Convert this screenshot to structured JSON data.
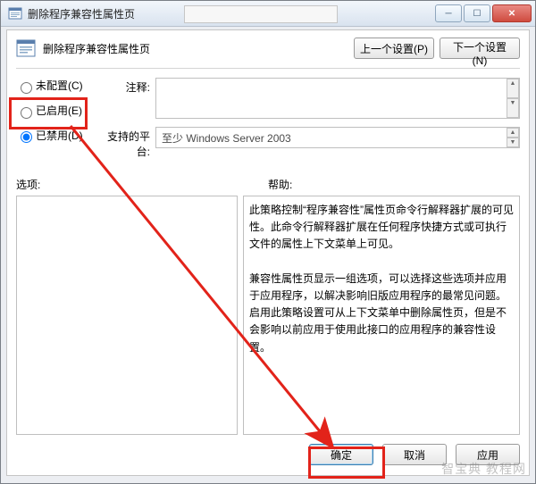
{
  "window": {
    "title": "删除程序兼容性属性页",
    "min_tip": "最小化",
    "max_tip": "最大化",
    "close_tip": "关闭"
  },
  "header": {
    "title": "删除程序兼容性属性页",
    "prev": "上一个设置(P)",
    "next": "下一个设置(N)"
  },
  "config": {
    "not_configured": "未配置(C)",
    "enabled": "已启用(E)",
    "disabled": "已禁用(D)",
    "selected": "disabled",
    "note_label": "注释:",
    "note_value": "",
    "platform_label": "支持的平台:",
    "platform_value": "至少 Windows Server 2003"
  },
  "labels": {
    "options": "选项:",
    "help": "帮助:"
  },
  "options_text": "",
  "help_text": "此策略控制“程序兼容性”属性页命令行解释器扩展的可见性。此命令行解释器扩展在任何程序快捷方式或可执行文件的属性上下文菜单上可见。\n\n兼容性属性页显示一组选项，可以选择这些选项并应用于应用程序，以解决影响旧版应用程序的最常见问题。启用此策略设置可从上下文菜单中删除属性页，但是不会影响以前应用于使用此接口的应用程序的兼容性设置。",
  "buttons": {
    "ok": "确定",
    "cancel": "取消",
    "apply": "应用"
  },
  "watermark": "智宝典 教程网"
}
